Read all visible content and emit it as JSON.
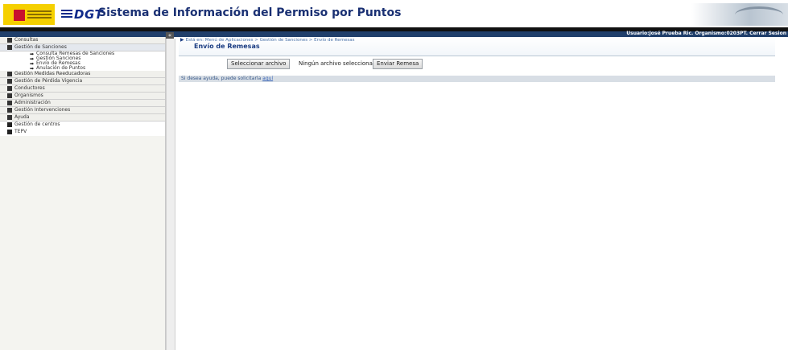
{
  "header": {
    "app_title": "Sistema de Información del Permiso por Puntos",
    "dgt_logo_text": "DGT"
  },
  "userbar": {
    "text": "Usuario:José Prueba Ric. Organismo:0203PT. Cerrar Sesion"
  },
  "sidebar": {
    "collapse_icon": "«",
    "items": [
      {
        "label": "Consultas"
      },
      {
        "label": "Gestión de Sanciones",
        "children": [
          {
            "label": "Consulta Remesas de Sanciones"
          },
          {
            "label": "Gestión Sanciones"
          },
          {
            "label": "Envío de Remesas"
          },
          {
            "label": "Anulación de Puntos"
          }
        ]
      },
      {
        "label": "Gestión Medidas Reeducadoras"
      },
      {
        "label": "Gestión de Pérdida Vigencia"
      },
      {
        "label": "Conductores"
      },
      {
        "label": "Organismos"
      },
      {
        "label": "Administración"
      },
      {
        "label": "Gestión Intervenciones"
      },
      {
        "label": "Ayuda"
      },
      {
        "label": "Gestión de centros"
      },
      {
        "label": "TEPV"
      }
    ]
  },
  "main": {
    "breadcrumb": "Está en: Menú de Aplicaciones  >  Gestión de Sanciones  >  Envío de Remesas",
    "page_title": "Envío de Remesas",
    "select_file_button": "Seleccionar archivo",
    "no_file_text": "Ningún archivo seleccionado",
    "send_button": "Enviar Remesa",
    "help_text": "Si desea ayuda, puede solicitarla ",
    "help_link": "aquí"
  }
}
